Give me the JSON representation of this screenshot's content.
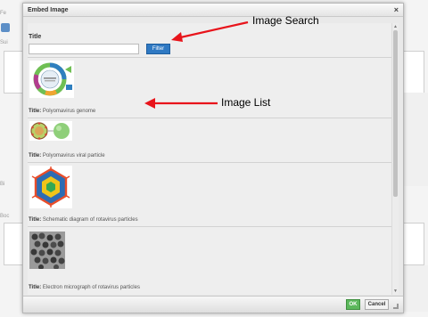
{
  "dialog": {
    "title": "Embed Image",
    "close_glyph": "×"
  },
  "search": {
    "label": "Title",
    "value": "",
    "placeholder": "",
    "filter_label": "Filter"
  },
  "images": [
    {
      "title_prefix": "Title:",
      "title": "Polyomavirus genome",
      "icon": "polyomavirus-genome-diagram"
    },
    {
      "title_prefix": "Title:",
      "title": "Polyomavirus viral particle",
      "icon": "polyomavirus-particle-illustration"
    },
    {
      "title_prefix": "Title:",
      "title": "Schematic diagram of rotavirus particles",
      "icon": "rotavirus-schematic-diagram"
    },
    {
      "title_prefix": "Title:",
      "title": "Electron micrograph of rotavirus particles",
      "icon": "rotavirus-micrograph"
    }
  ],
  "footer": {
    "ok_label": "OK",
    "cancel_label": "Cancel"
  },
  "annotations": {
    "search_callout": "Image Search",
    "list_callout": "Image List",
    "arrow_color": "#e8141b"
  },
  "background": {
    "label_1": "Fe",
    "label_2": "Sui",
    "label_3": "Boc",
    "label_4": "Bi"
  },
  "colors": {
    "filter_button": "#2f79c3",
    "ok_button": "#5cb85c"
  }
}
